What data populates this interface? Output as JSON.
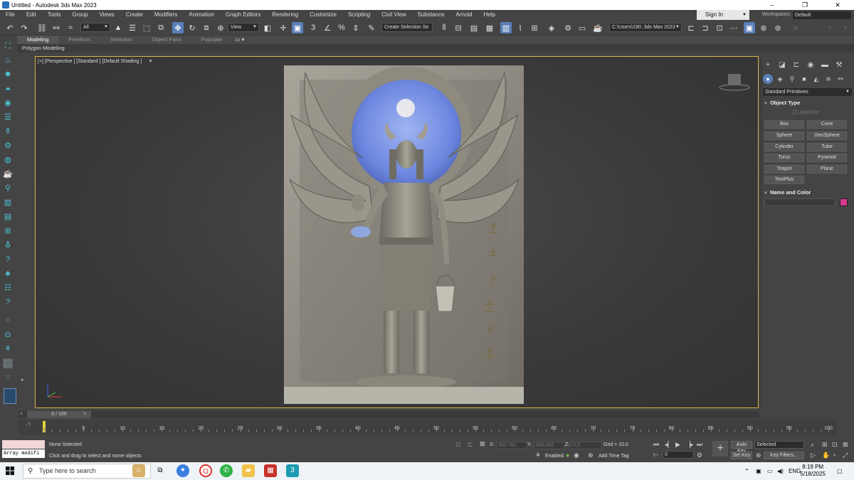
{
  "window": {
    "title": "Untitled - Autodesk 3ds Max 2023",
    "controls": [
      "–",
      "❐",
      "✕"
    ]
  },
  "menu": [
    "File",
    "Edit",
    "Tools",
    "Group",
    "Views",
    "Create",
    "Modifiers",
    "Animation",
    "Graph Editors",
    "Rendering",
    "Customize",
    "Scripting",
    "Civil View",
    "Substance",
    "Arnold",
    "Help"
  ],
  "account": {
    "signin": "Sign In",
    "workspace_label": "Workspaces:",
    "workspace_value": "Default"
  },
  "toolbar": {
    "filter_value": "All",
    "refcoord_value": "View",
    "selection_set_value": "Create Selection Se",
    "project_path": "C:\\Users\\190 .3ds Max 2023"
  },
  "ribbon": {
    "tabs": [
      "Modeling",
      "Freeform",
      "Selection",
      "Object Paint",
      "Populate"
    ],
    "active_tab": "Modeling",
    "sub_label": "Polygon Modeling"
  },
  "viewport": {
    "label": "[+] [Perspective ] [Standard ] [Default Shading ]"
  },
  "command_panel": {
    "category": "Standard Primitives",
    "object_type_title": "Object Type",
    "autogrid": "AutoGrid",
    "buttons": [
      "Box",
      "Cone",
      "Sphere",
      "GeoSphere",
      "Cylinder",
      "Tube",
      "Torus",
      "Pyramid",
      "Teapot",
      "Plane",
      "TextPlus"
    ],
    "name_color_title": "Name and Color",
    "object_color": "#d63a8e"
  },
  "timeline": {
    "slider_label": "0 / 100",
    "ticks": [
      "0",
      "5",
      "10",
      "15",
      "20",
      "25",
      "30",
      "35",
      "40",
      "45",
      "50",
      "55",
      "60",
      "65",
      "70",
      "75",
      "80",
      "85",
      "90",
      "95",
      "100"
    ]
  },
  "status": {
    "maxscript_text": "Array modifi",
    "selection": "None Selected",
    "prompt": "Click and drag to select and move objects",
    "x_label": "X:",
    "x_value": "362,781",
    "y_label": "Y:",
    "y_value": "346,062",
    "z_label": "Z:",
    "z_value": "0,0",
    "grid": "Grid = 10.0",
    "enabled": "Enabled:",
    "add_time_tag": "Add Time Tag",
    "frame_value": "0",
    "auto_key": "Auto Key",
    "set_key": "Set Key",
    "key_mode_value": "Selected",
    "key_filters": "Key Filters..."
  },
  "taskbar": {
    "search_placeholder": "Type here to search",
    "lang": "ENG",
    "time": "8:19 PM",
    "date": "5/18/2025"
  }
}
